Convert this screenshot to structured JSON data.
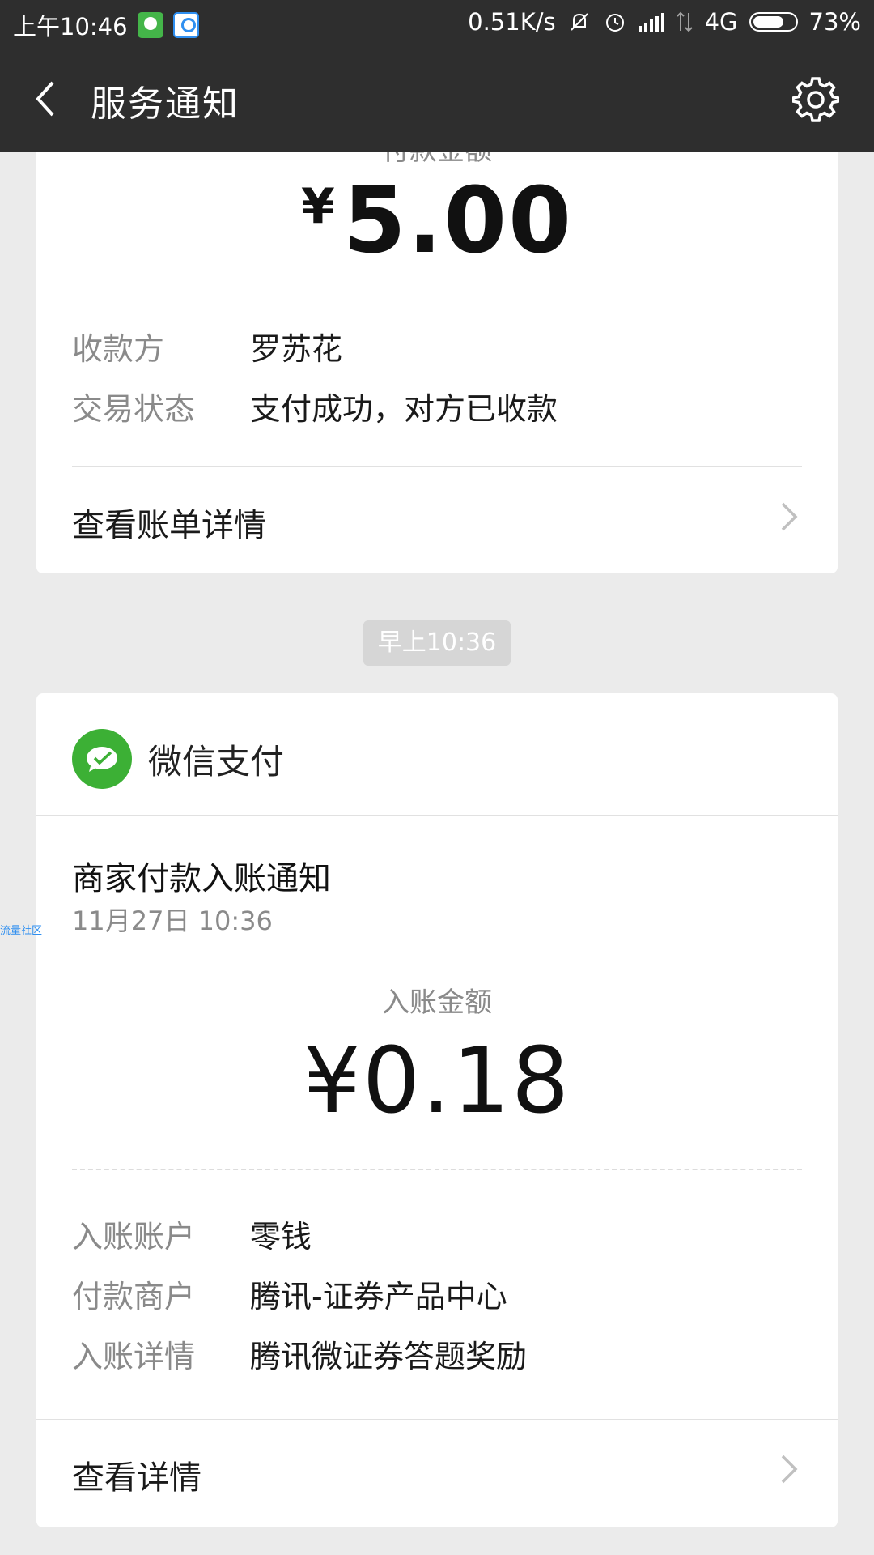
{
  "status_bar": {
    "time": "上午10:46",
    "net_speed": "0.51K/s",
    "network_type": "4G",
    "battery_percent": "73%",
    "battery_level": 0.73
  },
  "header": {
    "title": "服务通知"
  },
  "payment_card": {
    "amount_label": "付款金额",
    "currency": "¥",
    "amount": "5.00",
    "rows": [
      {
        "key": "收款方",
        "value": "罗苏花"
      },
      {
        "key": "交易状态",
        "value": "支付成功，对方已收款"
      }
    ],
    "link_label": "查看账单详情"
  },
  "timestamp_chip": "早上10:36",
  "income_card": {
    "brand_name": "微信支付",
    "notice_title": "商家付款入账通知",
    "notice_date": "11月27日  10:36",
    "amount_label": "入账金额",
    "amount": "¥0.18",
    "rows": [
      {
        "key": "入账账户",
        "value": "零钱"
      },
      {
        "key": "付款商户",
        "value": "腾讯-证券产品中心"
      },
      {
        "key": "入账详情",
        "value": "腾讯微证券答题奖励"
      }
    ],
    "link_label": "查看详情"
  },
  "edge_text": "流量社区",
  "colors": {
    "header_bg": "#2e2e2e",
    "page_bg": "#ebebeb",
    "wechat_green": "#3cb035"
  }
}
